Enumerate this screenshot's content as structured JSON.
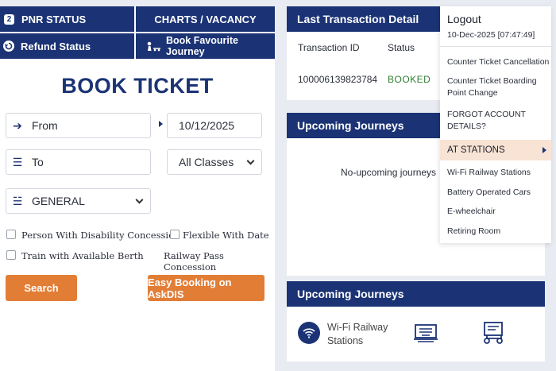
{
  "nav": {
    "pnr_status": "PNR STATUS",
    "pnr_icon": "2",
    "charts_vacancy": "CHARTS / VACANCY",
    "refund_status": "Refund Status",
    "book_favourite": "Book Favourite Journey"
  },
  "booking": {
    "title": "BOOK TICKET",
    "from_placeholder": "From",
    "to_placeholder": "To",
    "date": "10/12/2025",
    "class_select": "All Classes",
    "quota_select": "GENERAL",
    "checkboxes": [
      "Person With Disability Concession",
      "Flexible With Date",
      "Train with Available Berth",
      "Railway Pass Concession"
    ],
    "search_label": "Search",
    "askdis_label": "Easy Booking on AskDIS"
  },
  "transactions": {
    "title": "Last Transaction Detail",
    "col_id": "Transaction ID",
    "col_status": "Status",
    "row_id": "100006139823784",
    "row_status": "BOOKED"
  },
  "upcoming": {
    "title": "Upcoming Journeys",
    "empty_text": "No-upcoming journeys"
  },
  "upcoming2": {
    "title": "Upcoming Journeys",
    "service_label": "Wi-Fi Railway Stations"
  },
  "menu": {
    "logout": "Logout",
    "timestamp": "10-Dec-2025 [07:47:49]",
    "items": [
      "Counter Ticket Cancellation",
      "Counter Ticket Boarding Point Change",
      "FORGOT ACCOUNT DETAILS?",
      "AT STATIONS",
      "Wi-Fi Railway Stations",
      "Battery Operated Cars",
      "E-wheelchair",
      "Retiring Room"
    ]
  },
  "colors": {
    "navy": "#1b3375",
    "orange": "#e27d36",
    "booked_green": "#2e7d32",
    "highlight": "#f8e3d4"
  }
}
